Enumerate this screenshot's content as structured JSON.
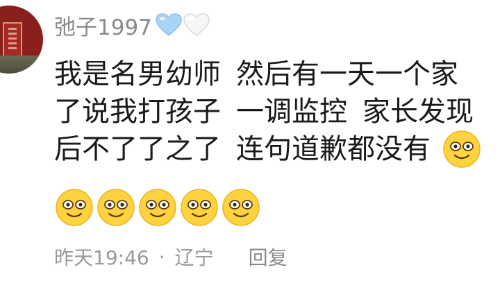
{
  "comment": {
    "username": "弛子1997",
    "badges": [
      {
        "icon": "blue-heart-icon",
        "color": "#a9d4f5"
      },
      {
        "icon": "white-heart-icon",
        "color": "#f4f4f4"
      }
    ],
    "text_lines": [
      [
        "我是名男幼师",
        "然后有一天一个家"
      ],
      [
        "了说我打孩子",
        "一调监控",
        "家长发现"
      ],
      [
        "后不了了之了",
        "连句道歉都没有"
      ]
    ],
    "emoji": "smile-emoji",
    "emoji_count_row": 5,
    "timestamp": "昨天19:46",
    "separator": "·",
    "location": "辽宁",
    "reply_label": "回复"
  },
  "colors": {
    "username": "#8a8a8a",
    "text": "#1a1a1a",
    "meta": "#9a9a9a",
    "emoji_face": "#ffd23f"
  }
}
